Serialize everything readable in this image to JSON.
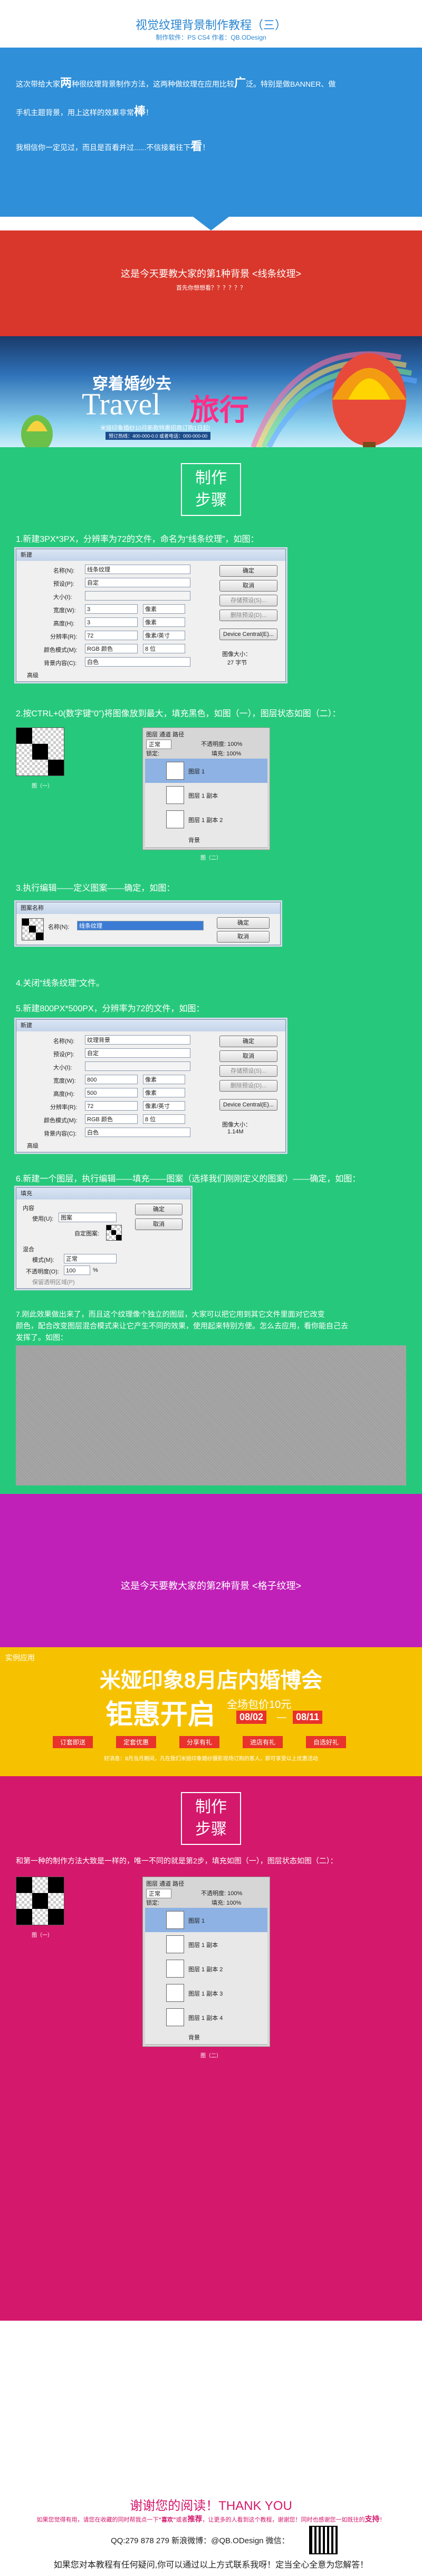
{
  "header": {
    "title": "视觉纹理背景制作教程（三）",
    "subtitle": "制作软件：PS CS4    作者：QB.ODesign"
  },
  "intro": {
    "line1a": "这次带给大家",
    "line1b": "两",
    "line1c": "种很纹理背景制作方法，这两种做纹理在应用比较",
    "line1d": "广",
    "line1e": "泛。特别是做BANNER、做",
    "line2": "手机主题背景，用上这样的效果非常",
    "line2b": "棒",
    "line2c": "！",
    "line3": "我相信你一定见过，而且是百看并过......不信接着往下",
    "line3b": "看",
    "line3c": "！",
    "colors": {
      "blue_bg": "#2f8fd8",
      "red_bg": "#d9372b",
      "green_bg": "#26c97b",
      "purple_bg": "#c020b8",
      "yellow_bg": "#f6c200",
      "magenta_bg": "#d4186b"
    }
  },
  "red_section": {
    "title": "这是今天要教大家的第1种背景 <线条纹理>",
    "sub": "首先你想想看？？？？？？"
  },
  "banner1": {
    "cn": "穿着婚纱去",
    "en": "Travel",
    "cn2": "旅行",
    "line1": "米娅印象婚纱10月新款特惠招商订购1日起!",
    "line2": "预订热线：400-000-0.0 或者电话：000-000-00"
  },
  "step_title": {
    "l1": "制作",
    "l2": "步骤"
  },
  "steps": {
    "s1": "1.新建3PX*3PX，分辨率为72的文件，命名为“线条纹理”，如图：",
    "s2": "2.按CTRL+0(数字键“0”)将图像放到最大，填充黑色，如图（一），图层状态如图（二）：",
    "s3": "3.执行编辑——定义图案——确定，如图：",
    "s4": "4.关闭“线条纹理”文件。",
    "s5": "5.新建800PX*500PX，分辨率为72的文件，如图：",
    "s6": "6.新建一个图层，执行编辑——填充——图案（选择我们刚刚定义的图案）——确定，如图：",
    "s7a": "7.刚此效果做出来了，而且这个纹理像个独立的图层，大家可以把它用到其它文件里面对它改变",
    "s7b": "颜色，配合改变图层混合模式来让它产生不同的效果，使用起来特别方便。怎么去应用，看你能自己去",
    "s7c": "发挥了。如图："
  },
  "fig": {
    "one": "图（一）",
    "two": "图（二）"
  },
  "dialog1": {
    "title": "新建",
    "name_label": "名称(N):",
    "name_value": "线条纹理",
    "preset_label": "预设(P):",
    "preset_value": "自定",
    "size_label": "大小(I):",
    "width_label": "宽度(W):",
    "width_value": "3",
    "width_unit": "像素",
    "height_label": "高度(H):",
    "height_value": "3",
    "height_unit": "像素",
    "res_label": "分辨率(R):",
    "res_value": "72",
    "res_unit": "像素/英寸",
    "mode_label": "颜色模式(M):",
    "mode_value": "RGB 颜色",
    "mode_bits": "8 位",
    "bg_label": "背景内容(C):",
    "bg_value": "白色",
    "adv_label": "高级",
    "ok": "确定",
    "cancel": "取消",
    "save": "存储预设(S)...",
    "delete": "删除预设(D)...",
    "device": "Device Central(E)...",
    "size_caption": "图像大小：",
    "size_value": "27 字节"
  },
  "layers1": {
    "tabs": "图层  通道  路径",
    "mode": "正常",
    "opacity": "不透明度: 100%",
    "lock": "锁定:",
    "fill": "填充: 100%",
    "l1": "图层 1",
    "l2": "图层 1 副本",
    "l3": "图层 1 副本 2",
    "bg": "背景"
  },
  "dialog2": {
    "title": "图案名称",
    "name_label": "名称(N):",
    "name_value": "线条纹理",
    "ok": "确定",
    "cancel": "取消"
  },
  "dialog3": {
    "title": "新建",
    "name_label": "名称(N):",
    "name_value": "纹理背景",
    "preset_label": "预设(P):",
    "preset_value": "自定",
    "size_label": "大小(I):",
    "width_label": "宽度(W):",
    "width_value": "800",
    "width_unit": "像素",
    "height_label": "高度(H):",
    "height_value": "500",
    "height_unit": "像素",
    "res_label": "分辨率(R):",
    "res_value": "72",
    "res_unit": "像素/英寸",
    "mode_label": "颜色模式(M):",
    "mode_value": "RGB 颜色",
    "mode_bits": "8 位",
    "bg_label": "背景内容(C):",
    "bg_value": "白色",
    "adv_label": "高级",
    "ok": "确定",
    "cancel": "取消",
    "save": "存储预设(S)...",
    "delete": "删除预设(D)...",
    "device": "Device Central(E)...",
    "size_caption": "图像大小：",
    "size_value": "1.14M"
  },
  "dialog4": {
    "title": "填充",
    "content_label": "内容",
    "use_label": "使用(U):",
    "use_value": "图案",
    "custom_label": "自定图案:",
    "blend_label": "混合",
    "mode_label": "模式(M):",
    "mode_value": "正常",
    "opacity_label": "不透明度(O):",
    "opacity_value": "100",
    "opacity_unit": "%",
    "preserve": "保留透明区域(P)",
    "ok": "确定",
    "cancel": "取消"
  },
  "purple_section": {
    "title": "这是今天要教大家的第2种背景 <格子纹理>"
  },
  "yellow_banner": {
    "tag": "实例应用",
    "title": "米娅印象8月店内婚博会",
    "big": "钜惠开启",
    "side": "全场包价10元",
    "d1": "08/02",
    "dash": "—",
    "d2": "08/11",
    "b1": "订套即送",
    "b2": "定套优惠",
    "b3": "分享有礼",
    "b4": "进店有礼",
    "b5": "自选好礼",
    "small": "好消息：8月当月期间，凡在我们米娅印象婚纱摄影现场订购的客人，即可享受以上优惠活动"
  },
  "step_b": {
    "l1": "制作",
    "l2": "步骤",
    "text": "和第一种的制作方法大致是一样的，唯一不同的就是第2步，填充如图（一），图层状态如图（二）："
  },
  "layers2": {
    "tabs": "图层  通道  路径",
    "mode": "正常",
    "opacity": "不透明度: 100%",
    "lock": "锁定:",
    "fill": "填充: 100%",
    "l1": "图层 1",
    "l2": "图层 1 副本",
    "l3": "图层 1 副本 2",
    "l4": "图层 1 副本 3",
    "l5": "图层 1 副本 4",
    "bg": "背景"
  },
  "footer": {
    "thanks": "谢谢您的阅读！THANK YOU",
    "line1a": "如果您觉得有用，请您在收藏的同时帮我点一下",
    "line1b": "“喜欢”",
    "line1c": "或者",
    "line1d": "推荐",
    "line1e": "，让更多的人看到这个教程，谢谢您！同时也感谢您一",
    "line1f": "如既往的",
    "line1g": "支持",
    "line1h": "！",
    "contact": "QQ:279 878 279    新浪微博：@QB.ODesign    微信：",
    "question": "如果您对本教程有任何疑问,你可以通过以上方式联系我呀！定当全心全意为您解答！"
  }
}
